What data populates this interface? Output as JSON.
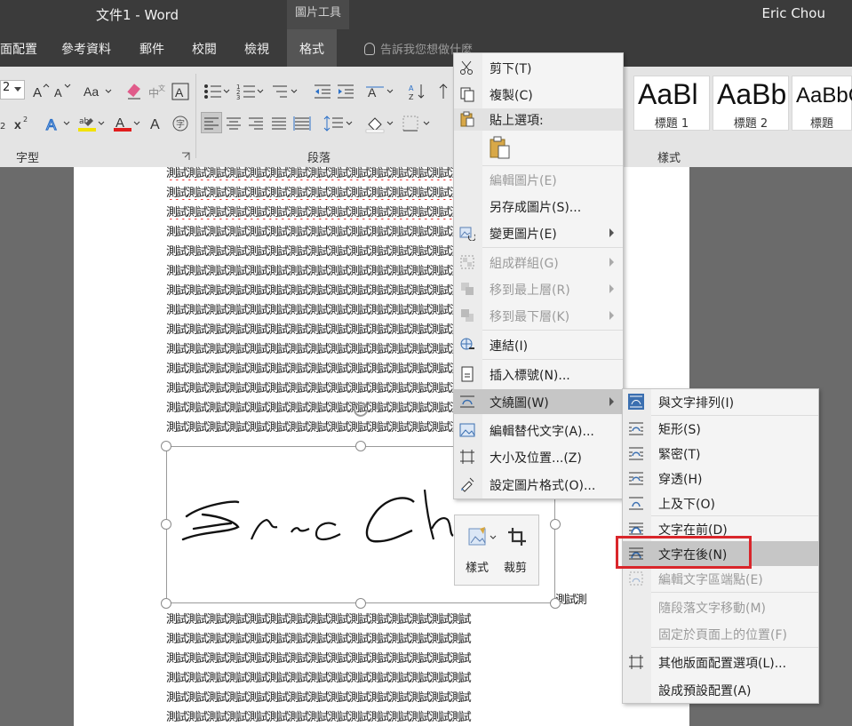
{
  "titlebar": {
    "title": "文件1  -  Word",
    "context_tab": "圖片工具",
    "user": "Eric Chou"
  },
  "tabs": [
    {
      "label": "面配置"
    },
    {
      "label": "參考資料"
    },
    {
      "label": "郵件"
    },
    {
      "label": "校閱"
    },
    {
      "label": "檢視"
    },
    {
      "label": "格式"
    }
  ],
  "tellme": {
    "placeholder": "告訴我您想做什麼"
  },
  "ribbon": {
    "font_size_value": "2",
    "groups": {
      "font": "字型",
      "paragraph": "段落",
      "styles": "樣式"
    },
    "styles": [
      {
        "sample": "AaBl",
        "name": "標題 1"
      },
      {
        "sample": "AaBb",
        "name": "標題 2"
      },
      {
        "sample": "AaBbC",
        "name": "標題"
      }
    ]
  },
  "document": {
    "text_line": "測試測試測試測試測試測試測試測試測試測試測試測試測試測試測試",
    "tail_text": "測試測"
  },
  "mini_toolbar": {
    "style_label": "樣式",
    "crop_label": "裁剪"
  },
  "context_menu": {
    "cut": "剪下(T)",
    "copy": "複製(C)",
    "paste_options": "貼上選項:",
    "edit_picture": "編輯圖片(E)",
    "save_as_picture": "另存成圖片(S)...",
    "change_picture": "變更圖片(E)",
    "group": "組成群組(G)",
    "bring_to_front": "移到最上層(R)",
    "send_to_back": "移到最下層(K)",
    "link": "連結(I)",
    "insert_caption": "插入標號(N)...",
    "wrap_text": "文繞圖(W)",
    "edit_alt_text": "編輯替代文字(A)...",
    "size_position": "大小及位置...(Z)",
    "format_picture": "設定圖片格式(O)..."
  },
  "wrap_submenu": {
    "in_line": "與文字排列(I)",
    "square": "矩形(S)",
    "tight": "緊密(T)",
    "through": "穿透(H)",
    "top_bottom": "上及下(O)",
    "in_front": "文字在前(D)",
    "behind": "文字在後(N)",
    "edit_wrap_points": "編輯文字區端點(E)",
    "move_with_text": "隨段落文字移動(M)",
    "fix_position": "固定於頁面上的位置(F)",
    "more_layout": "其他版面配置選項(L)...",
    "set_default": "設成預設配置(A)"
  },
  "colors": {
    "highlight_red": "#d9262b",
    "menu_hover": "#c6c6c6",
    "accent_blue": "#2b579a"
  }
}
